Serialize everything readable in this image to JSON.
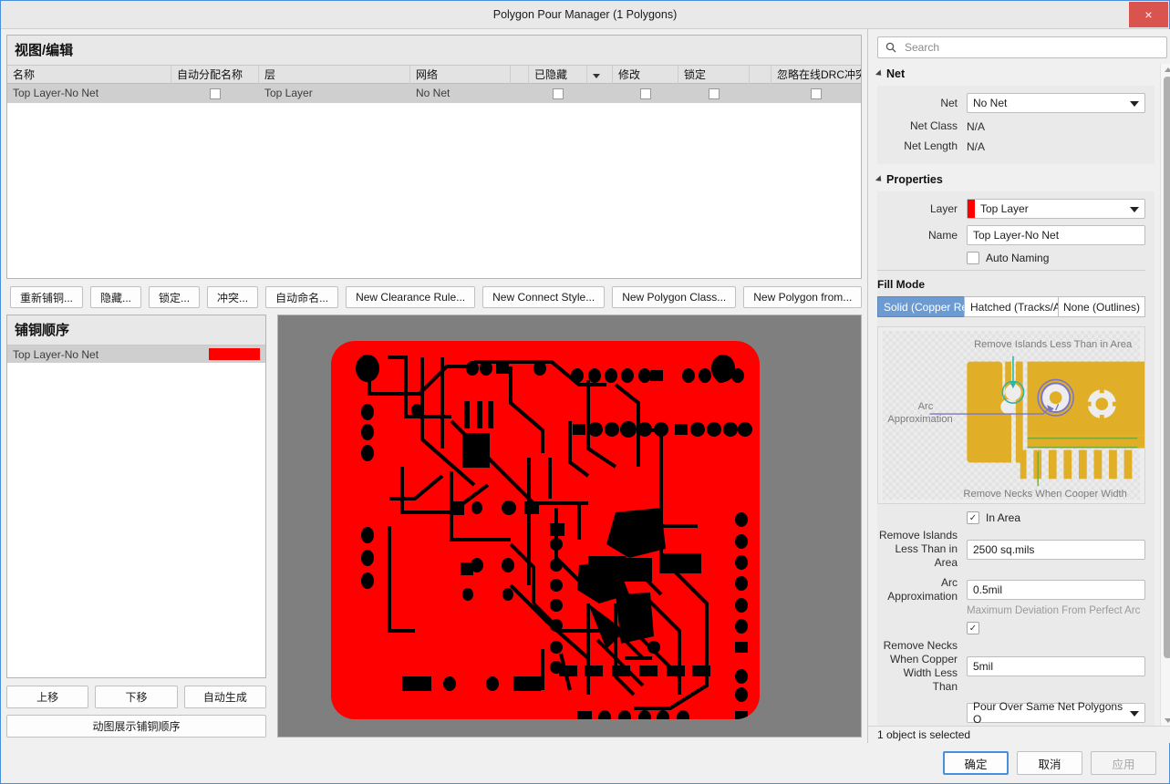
{
  "window": {
    "title": "Polygon Pour Manager (1 Polygons)",
    "close_label": "×"
  },
  "view_edit": {
    "header": "视图/编辑",
    "columns": [
      "名称",
      "自动分配名称",
      "层",
      "网络",
      "已隐藏",
      "修改",
      "锁定",
      "忽略在线DRC冲突"
    ],
    "rows": [
      {
        "name": "Top Layer-No Net",
        "auto_name": false,
        "layer": "Top Layer",
        "net": "No Net",
        "hidden": false,
        "modified": false,
        "locked": false,
        "ignore_drc": false
      }
    ]
  },
  "toolbar": {
    "buttons": [
      "重新铺铜...",
      "隐藏...",
      "锁定...",
      "冲突...",
      "自动命名...",
      "New Clearance Rule...",
      "New Connect Style...",
      "New Polygon Class...",
      "New Polygon from..."
    ]
  },
  "pour_order": {
    "header": "铺铜顺序",
    "rows": [
      {
        "name": "Top Layer-No Net",
        "color": "#ff0000"
      }
    ],
    "buttons": [
      "上移",
      "下移",
      "自动生成"
    ],
    "wide_button": "动图展示铺铜顺序"
  },
  "preview": {
    "background": "#7f7f7f",
    "copper_color": "#ff0000"
  },
  "search": {
    "placeholder": "Search",
    "value": ""
  },
  "net_section": {
    "title": "Net",
    "net_label": "Net",
    "net_value": "No Net",
    "net_class_label": "Net Class",
    "net_class_value": "N/A",
    "net_length_label": "Net Length",
    "net_length_value": "N/A"
  },
  "properties_section": {
    "title": "Properties",
    "layer_label": "Layer",
    "layer_value": "Top Layer",
    "layer_color": "#ff0000",
    "name_label": "Name",
    "name_value": "Top Layer-No Net",
    "auto_naming_label": "Auto Naming",
    "auto_naming_checked": false
  },
  "fill_mode": {
    "title": "Fill Mode",
    "options": [
      "Solid (Copper Region)",
      "Hatched (Tracks/Arcs)",
      "None (Outlines)"
    ],
    "selected": "Solid (Copper Region)"
  },
  "illustration": {
    "label_top": "Remove Islands Less Than in Area",
    "label_left": "Arc\nApproximation",
    "label_left_line1": "Arc",
    "label_left_line2": "Approximation",
    "label_bottom": "Remove Necks When Cooper Width",
    "copper_color": "#e0ae27",
    "accent_green": "#2fb3a3",
    "accent_purple": "#7b76c4"
  },
  "fill_settings": {
    "in_area_label": "In Area",
    "in_area_checked": true,
    "remove_islands_label": "Remove Islands Less Than in Area",
    "remove_islands_value": "2500 sq.mils",
    "arc_approx_label": "Arc Approximation",
    "arc_approx_value": "0.5mil",
    "arc_approx_hint": "Maximum Deviation From Perfect Arc",
    "remove_necks_checked": true,
    "remove_necks_label": "Remove Necks When Copper Width Less Than",
    "remove_necks_value": "5mil",
    "pour_over_value": "Pour Over Same Net Polygons O"
  },
  "status": {
    "text": "1 object is selected"
  },
  "dialog_buttons": {
    "ok": "确定",
    "cancel": "取消",
    "apply": "应用"
  }
}
